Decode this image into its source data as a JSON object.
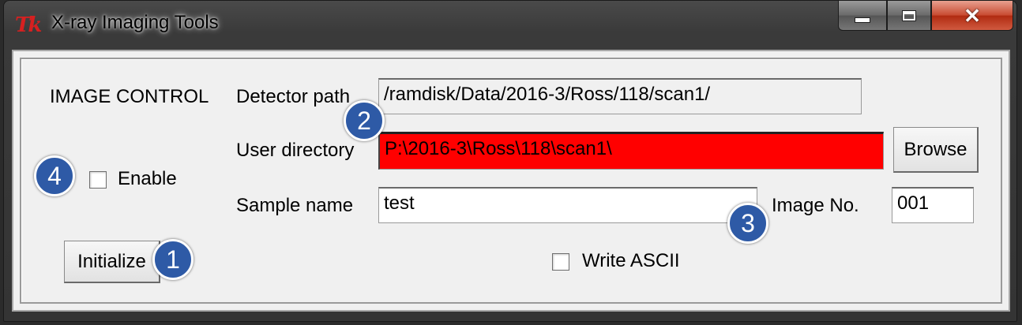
{
  "window": {
    "title": "X-ray Imaging Tools",
    "app_icon_text": "Tk",
    "controls": {
      "minimize": "minimize",
      "maximize": "maximize",
      "close": "✕"
    }
  },
  "image_control": {
    "heading": "IMAGE CONTROL",
    "enable_label": "Enable",
    "enable_checked": false,
    "initialize_label": "Initialize"
  },
  "fields": {
    "detector_path_label": "Detector path",
    "detector_path_value": "/ramdisk/Data/2016-3/Ross/118/scan1/",
    "user_directory_label": "User directory",
    "user_directory_value": "P:\\2016-3\\Ross\\118\\scan1\\",
    "user_directory_bg": "#ff0000",
    "browse_label": "Browse",
    "sample_name_label": "Sample name",
    "sample_name_value": "test",
    "image_no_label": "Image No.",
    "image_no_value": "001",
    "write_ascii_label": "Write ASCII",
    "write_ascii_checked": false
  },
  "annotations": [
    "1",
    "2",
    "3",
    "4"
  ],
  "colors": {
    "badge": "#2e5aa6",
    "app_icon": "#d62020"
  }
}
